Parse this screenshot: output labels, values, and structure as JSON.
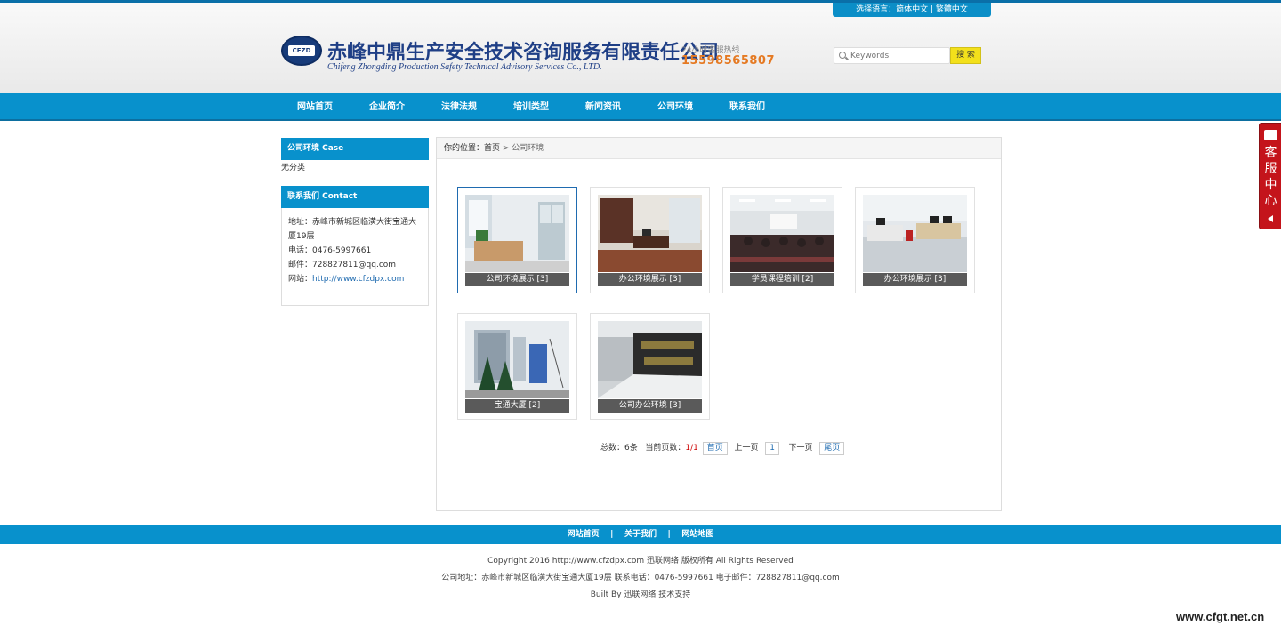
{
  "header": {
    "lang_label": "选择语言：",
    "lang_simplified": "简体中文",
    "lang_sep": " | ",
    "lang_traditional": "繁體中文",
    "logo_text": "CFZD",
    "company_cn": "赤峰中鼎生产安全技术咨询服务有限责任公司",
    "company_en": "Chifeng Zhongding Production Safety Technical Advisory Services Co., LTD.",
    "hotline_label": "24小时客服热线",
    "hotline_number": "15598565807",
    "search_placeholder": "Keywords",
    "search_button": "搜 索"
  },
  "nav": [
    {
      "label": "网站首页"
    },
    {
      "label": "企业简介"
    },
    {
      "label": "法律法规"
    },
    {
      "label": "培训类型"
    },
    {
      "label": "新闻资讯"
    },
    {
      "label": "公司环境"
    },
    {
      "label": "联系我们"
    }
  ],
  "sidebar": {
    "category_title": "公司环境    Case",
    "category_empty": "无分类",
    "contact_title": "联系我们    Contact",
    "address_line1": "地址：赤峰市新城区临潢大街宝通大",
    "address_line2": "厦19层",
    "phone": "电话：0476-5997661",
    "email": "邮件：728827811@qq.com",
    "website_label": "网站：",
    "website_url": "http://www.cfzdpx.com"
  },
  "breadcrumb": {
    "prefix": "你的位置：",
    "home": "首页",
    "sep": " > ",
    "current": "公司环境"
  },
  "gallery": [
    {
      "caption": "公司环境展示 [3]"
    },
    {
      "caption": "办公环境展示 [3]"
    },
    {
      "caption": "学员课程培训 [2]"
    },
    {
      "caption": "办公环境展示 [3]"
    },
    {
      "caption": "宝通大厦 [2]"
    },
    {
      "caption": "公司办公环境 [3]"
    }
  ],
  "pager": {
    "total": "总数：6条",
    "current_label": "当前页数：",
    "current_value": "1/1",
    "first": "首页",
    "prev": "上一页",
    "page": "1",
    "next": "下一页",
    "last": "尾页"
  },
  "footer": {
    "link_home": "网站首页",
    "link_about": "关于我们",
    "link_map": "网站地图",
    "sep": "|",
    "copyright": "Copyright 2016 http://www.cfzdpx.com 迅联网络 版权所有 All Rights Reserved",
    "address": "公司地址：赤峰市新城区临潢大街宝通大厦19层 联系电话：0476-5997661 电子邮件：728827811@qq.com",
    "built_by": "Built By 迅联网络 技术支持"
  },
  "service_tab": {
    "c1": "客",
    "c2": "服",
    "c3": "中",
    "c4": "心"
  },
  "watermark": "www.cfgt.net.cn"
}
